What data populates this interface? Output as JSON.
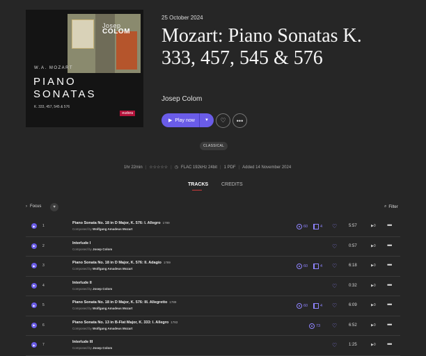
{
  "cover": {
    "composer_text": "W.A. MOZART",
    "title_line1": "PIANO",
    "title_line2": "SONATAS",
    "works": "K. 333, 457, 545 & 576",
    "artist_line1": "Josep",
    "artist_line2": "COLOM",
    "label": "eudora"
  },
  "album": {
    "release_date": "25 October 2024",
    "title": "Mozart: Piano Sonatas K. 333, 457, 545 & 576",
    "artist": "Josep Colom"
  },
  "actions": {
    "play_label": "Play now",
    "play_icon": "play-icon",
    "dropdown_icon": "chevron-down-icon",
    "favorite_icon": "heart-icon",
    "more_icon": "more-icon"
  },
  "genre": "CLASSICAL",
  "meta": {
    "duration": "1hr 22min",
    "rating": "☆☆☆☆☆",
    "format": "FLAC 192kHz 24bit",
    "pdf": "1 PDF",
    "added": "Added 14 November 2024"
  },
  "tabs": {
    "tracks": "TRACKS",
    "credits": "CREDITS"
  },
  "toolbar": {
    "focus": "Focus",
    "filter": "Filter"
  },
  "tracks": [
    {
      "num": "1",
      "title": "Piano Sonata No. 18 in D Major, K. 576: I. Allegro",
      "year": "1789",
      "composed_by": "Composed by",
      "composer": "Wolfgang Amadeus Mozart",
      "listens": "60",
      "saves": "4",
      "duration": "5:57",
      "plays": "0"
    },
    {
      "num": "2",
      "title": "Interlude I",
      "year": "",
      "composed_by": "Composed by",
      "composer": "Josep Colom",
      "listens": "",
      "saves": "",
      "duration": "0:57",
      "plays": "0"
    },
    {
      "num": "3",
      "title": "Piano Sonata No. 18 in D Major, K. 576: II. Adagio",
      "year": "1789",
      "composed_by": "Composed by",
      "composer": "Wolfgang Amadeus Mozart",
      "listens": "60",
      "saves": "4",
      "duration": "6:18",
      "plays": "0"
    },
    {
      "num": "4",
      "title": "Interlude II",
      "year": "",
      "composed_by": "Composed by",
      "composer": "Josep Colom",
      "listens": "",
      "saves": "",
      "duration": "0:32",
      "plays": "0"
    },
    {
      "num": "5",
      "title": "Piano Sonata No. 18 in D Major, K. 576: III. Allegretto",
      "year": "1789",
      "composed_by": "Composed by",
      "composer": "Wolfgang Amadeus Mozart",
      "listens": "60",
      "saves": "4",
      "duration": "6:09",
      "plays": "0"
    },
    {
      "num": "6",
      "title": "Piano Sonata No. 13 in B-Flat Major, K. 333: I. Allegro",
      "year": "1783",
      "composed_by": "Composed by",
      "composer": "Wolfgang Amadeus Mozart",
      "listens": "73",
      "saves": "",
      "duration": "6:52",
      "plays": "0"
    },
    {
      "num": "7",
      "title": "Interlude III",
      "year": "",
      "composed_by": "Composed by",
      "composer": "Josep Colom",
      "listens": "",
      "saves": "",
      "duration": "1:25",
      "plays": "0"
    }
  ],
  "colors": {
    "accent": "#6a5ce8",
    "accent_light": "#8f84ff",
    "background": "#262626",
    "tab_underline": "#c93b3b"
  }
}
